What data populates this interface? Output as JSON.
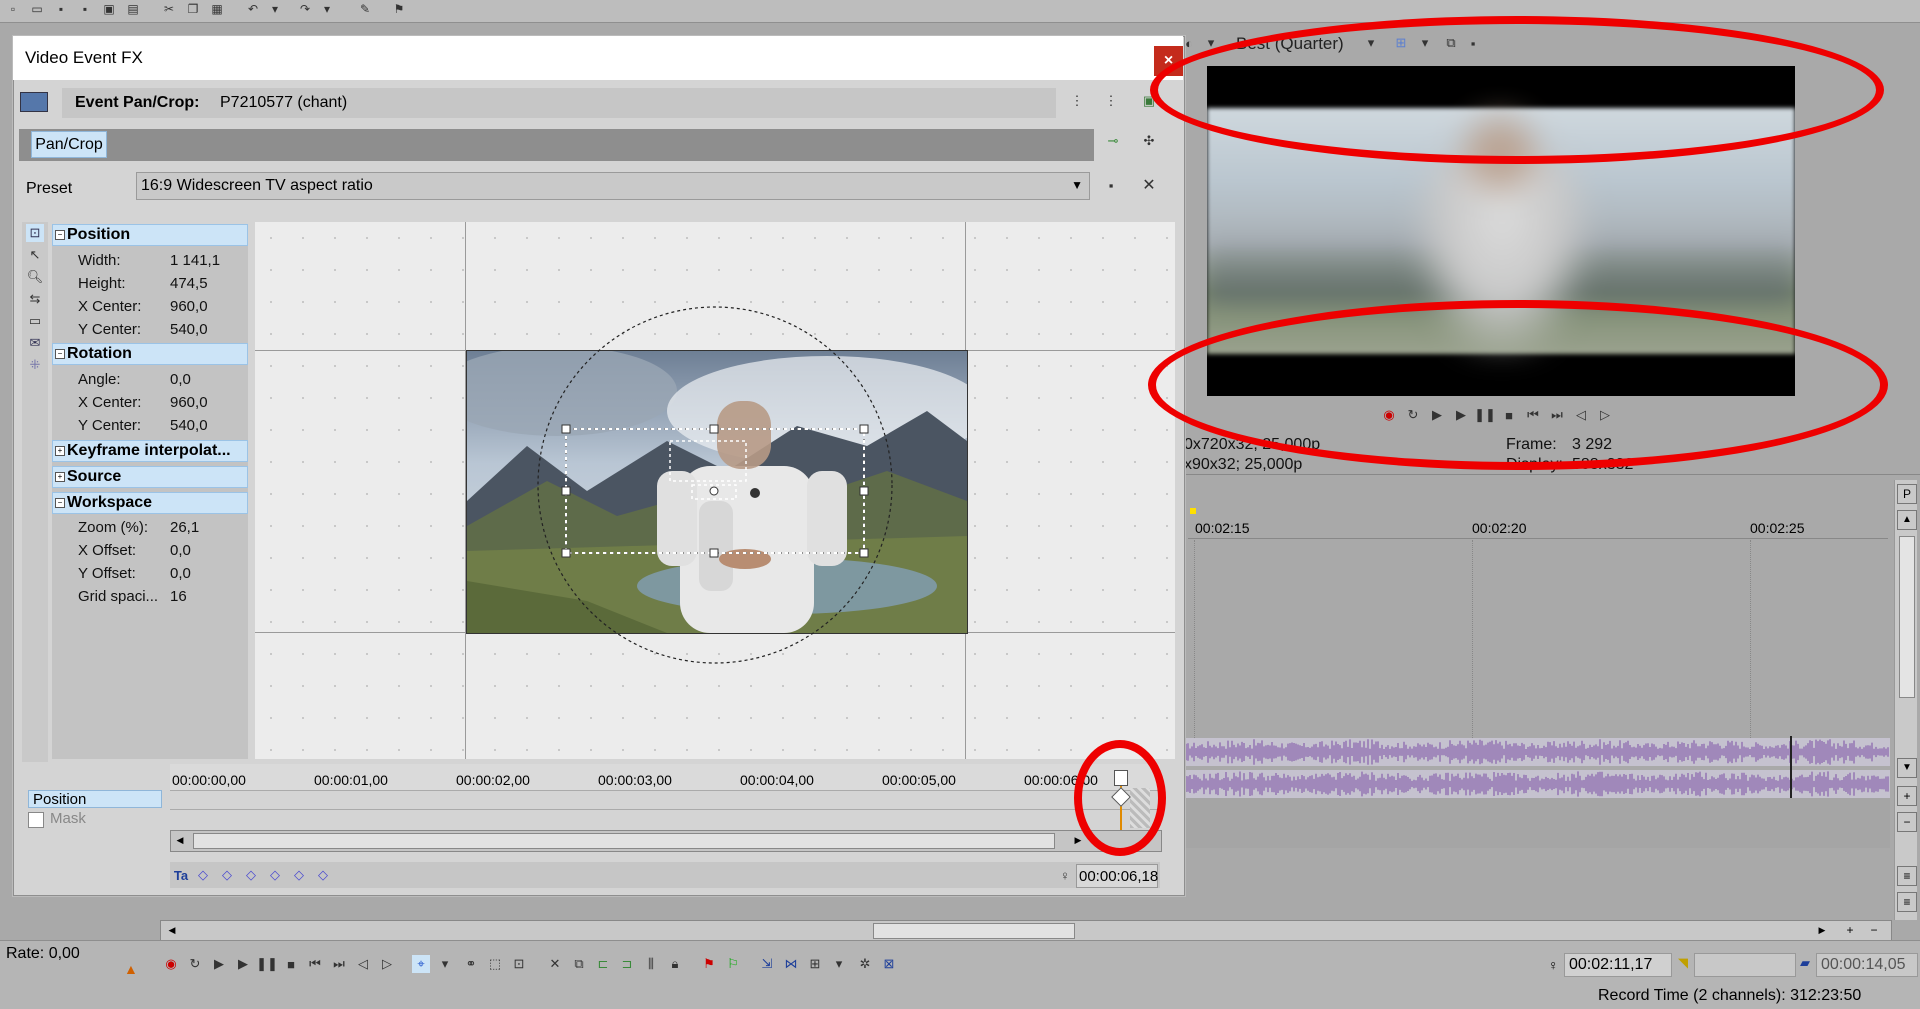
{
  "dialog": {
    "title": "Video Event FX",
    "close_label": "×",
    "event_label": "Event Pan/Crop:",
    "event_name": "P7210577 (chant)",
    "tab_label": "Pan/Crop",
    "preset_label": "Preset",
    "preset_value": "16:9 Widescreen TV aspect ratio"
  },
  "properties": {
    "position": {
      "title": "Position",
      "rows": [
        {
          "name": "Width:",
          "value": "1 141,1"
        },
        {
          "name": "Height:",
          "value": "474,5"
        },
        {
          "name": "X Center:",
          "value": "960,0"
        },
        {
          "name": "Y Center:",
          "value": "540,0"
        }
      ]
    },
    "rotation": {
      "title": "Rotation",
      "rows": [
        {
          "name": "Angle:",
          "value": "0,0"
        },
        {
          "name": "X Center:",
          "value": "960,0"
        },
        {
          "name": "Y Center:",
          "value": "540,0"
        }
      ]
    },
    "keyframe": {
      "title": "Keyframe interpolat..."
    },
    "source": {
      "title": "Source"
    },
    "workspace": {
      "title": "Workspace",
      "rows": [
        {
          "name": "Zoom (%):",
          "value": "26,1"
        },
        {
          "name": "X Offset:",
          "value": "0,0"
        },
        {
          "name": "Y Offset:",
          "value": "0,0"
        },
        {
          "name": "Grid spaci...",
          "value": "16"
        }
      ]
    }
  },
  "kf_timeline": {
    "ticks": [
      "00:00:00,00",
      "00:00:01,00",
      "00:00:02,00",
      "00:00:03,00",
      "00:00:04,00",
      "00:00:05,00",
      "00:00:06,00"
    ],
    "tracks": [
      "Position",
      "Mask"
    ],
    "cursor_time": "00:00:06,18"
  },
  "preview": {
    "quality": "Best (Quarter)",
    "project_info": "0x720x32; 25,000p",
    "preview_info": "x90x32; 25,000p",
    "frame_label": "Frame:",
    "frame_value": "3 292",
    "display_label": "Display:",
    "display_value": "588x332"
  },
  "timeline": {
    "ticks": [
      "00:02:15",
      "00:02:20",
      "00:02:25"
    ],
    "rate": "Rate: 0,00",
    "cursor_time": "00:02:11,17",
    "length_time": "00:00:14,05",
    "record_time": "Record Time (2 channels): 312:23:50"
  },
  "colors": {
    "accent_blue": "#cce4f7",
    "close_red": "#c42b1c",
    "annotation_red": "#e00000",
    "waveform": "#7b4fa5"
  }
}
